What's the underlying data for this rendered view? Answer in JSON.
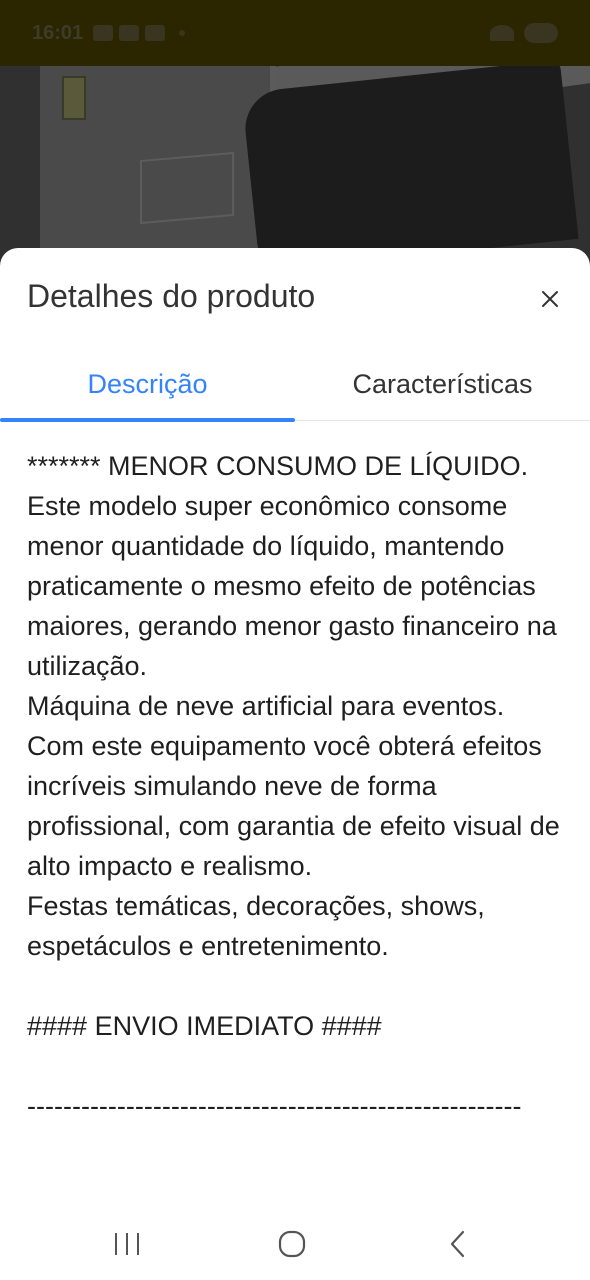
{
  "status_bar": {
    "time": "16:01"
  },
  "sheet": {
    "title": "Detalhes do produto",
    "close_icon": "close-icon",
    "tabs": [
      {
        "label": "Descrição",
        "active": true
      },
      {
        "label": "Características",
        "active": false
      }
    ],
    "accent_color": "#3483fa",
    "description": "******* MENOR CONSUMO DE LÍQUIDO.\nEste modelo super econômico consome menor quantidade do líquido, mantendo praticamente o mesmo efeito de potências maiores, gerando menor gasto financeiro na utilização.\nMáquina de neve artificial para eventos.\nCom este equipamento você obterá efeitos incríveis simulando neve de forma profissional, com garantia de efeito visual de alto impacto e realismo.\nFestas temáticas, decorações, shows, espetáculos e entretenimento.\n\n#### ENVIO IMEDIATO ####\n\n-------------------------------------------------------"
  },
  "nav_bar": {
    "recent_icon": "recent-apps-icon",
    "home_icon": "home-icon",
    "back_icon": "back-icon"
  }
}
